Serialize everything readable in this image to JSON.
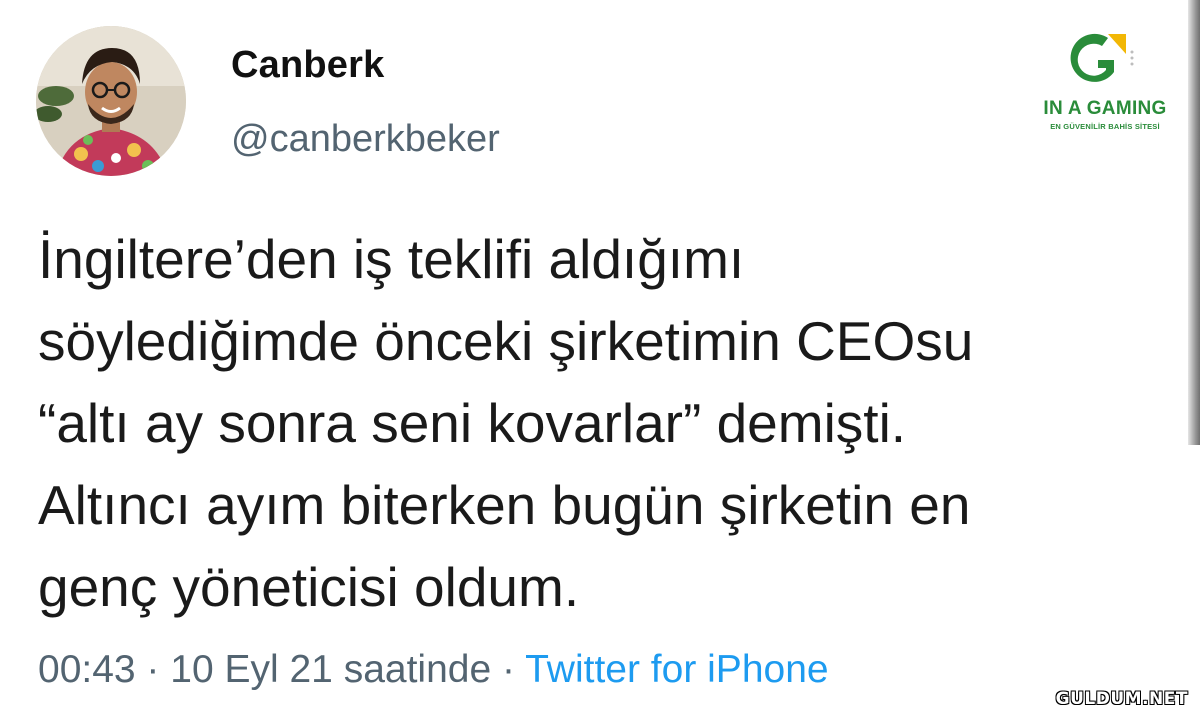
{
  "tweet": {
    "display_name": "Canberk",
    "handle": "@canberkbeker",
    "text_lines": [
      "İngiltere’den iş teklifi aldığımı",
      "söylediğimde önceki şirketimin CEOsu",
      "“altı ay sonra seni kovarlar” demişti.",
      "Altıncı ayım biterken bugün şirketin en",
      "genç yöneticisi oldum."
    ],
    "timestamp": "00:43 · 10 Eyl 21 saatinde · ",
    "source": "Twitter for iPhone"
  },
  "brand": {
    "name": "IN A GAMING",
    "tagline": "EN GÜVENİLİR BAHİS SİTESİ",
    "color": "#2a8c3a",
    "accent_color": "#f2b705"
  },
  "watermark": {
    "text": "GULDUM.NET"
  },
  "colors": {
    "text": "#1a1a1a",
    "secondary": "#536471",
    "link": "#1d9bf0"
  }
}
